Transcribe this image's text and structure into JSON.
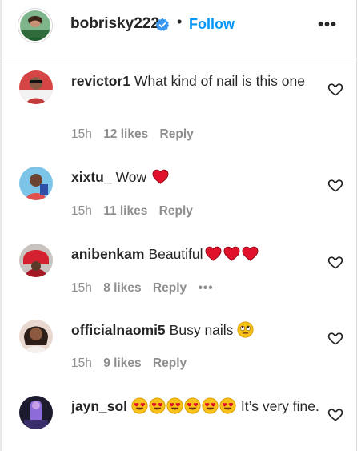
{
  "colors": {
    "follow": "#0095f6",
    "verified": "#3897f0",
    "heart_emoji": "#e0112b",
    "meta": "#8e8e8e"
  },
  "post": {
    "username": "bobrisky222",
    "separator": "•",
    "follow_label": "Follow",
    "more_label": "•••"
  },
  "comments": [
    {
      "username": "revictor1",
      "text": "What kind of nail is this one",
      "time": "15h",
      "likes": "12 likes",
      "reply": "Reply"
    },
    {
      "username": "xixtu_",
      "text": "Wow",
      "time": "15h",
      "likes": "11 likes",
      "reply": "Reply"
    },
    {
      "username": "anibenkam",
      "text": "Beautiful",
      "time": "15h",
      "likes": "8 likes",
      "reply": "Reply",
      "more": "•••"
    },
    {
      "username": "officialnaomi5",
      "text": "Busy nails",
      "time": "15h",
      "likes": "9 likes",
      "reply": "Reply"
    },
    {
      "username": "jayn_sol",
      "text": "It’s very fine.",
      "time": "",
      "likes": "",
      "reply": ""
    }
  ],
  "icons": {
    "verified": "verified-badge-icon",
    "like": "heart-outline-icon",
    "red_heart": "red-heart-emoji",
    "eye_roll": "rolling-eyes-emoji",
    "heart_eyes": "heart-eyes-emoji"
  }
}
